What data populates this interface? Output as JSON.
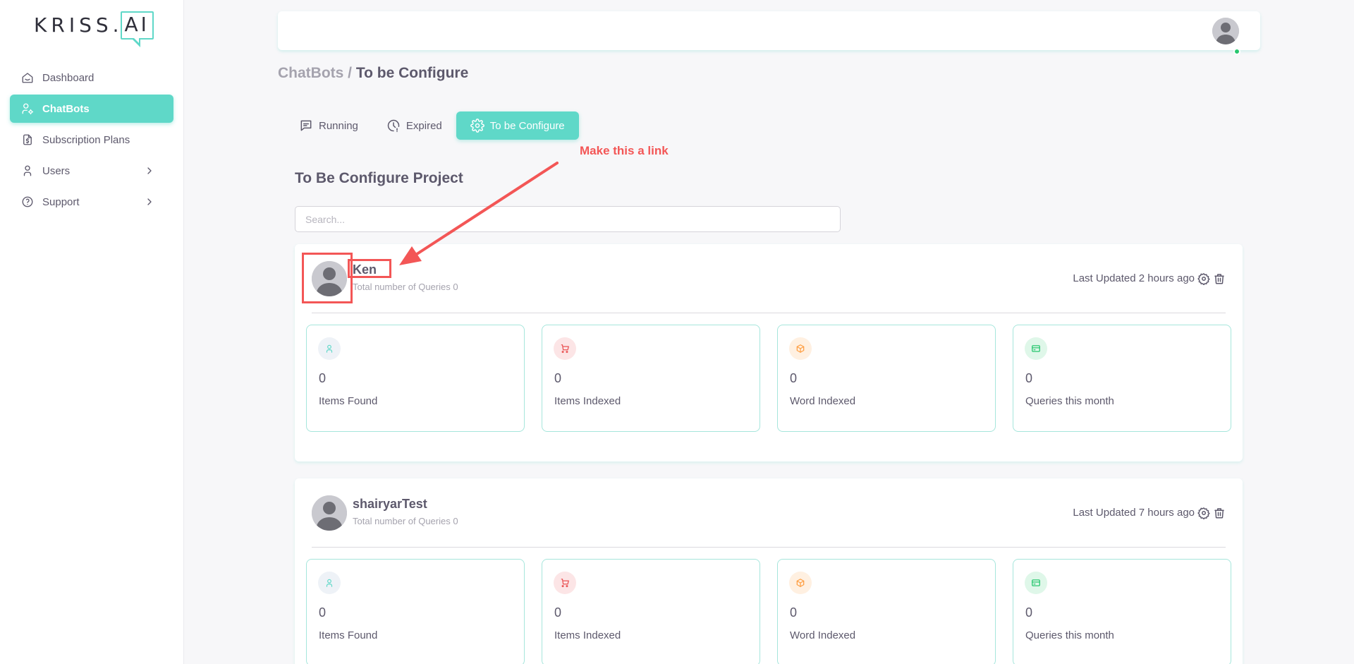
{
  "logo": {
    "text": "KRISS",
    "accent": "AI",
    "dot": "."
  },
  "sidebar": {
    "items": [
      {
        "label": "Dashboard",
        "icon": "home-icon",
        "active": false
      },
      {
        "label": "ChatBots",
        "icon": "user-cog-icon",
        "active": true
      },
      {
        "label": "Subscription Plans",
        "icon": "file-dollar-icon",
        "active": false
      },
      {
        "label": "Users",
        "icon": "user-icon",
        "active": false,
        "has_children": true
      },
      {
        "label": "Support",
        "icon": "help-circle-icon",
        "active": false,
        "has_children": true
      }
    ]
  },
  "breadcrumb": {
    "parent": "ChatBots /",
    "current": "To be Configure"
  },
  "tabs": [
    {
      "label": "Running",
      "icon": "message-icon",
      "active": false
    },
    {
      "label": "Expired",
      "icon": "clock-icon",
      "active": false
    },
    {
      "label": "To be Configure",
      "icon": "settings-icon",
      "active": true
    }
  ],
  "annotation": {
    "text": "Make this a link"
  },
  "section_title": "To Be Configure Project",
  "search": {
    "placeholder": "Search...",
    "value": ""
  },
  "projects": [
    {
      "name": "Ken",
      "subtitle": "Total number of Queries 0",
      "updated": "Last Updated 2 hours ago",
      "stats": [
        {
          "value": "0",
          "label": "Items Found",
          "icon": "user-icon"
        },
        {
          "value": "0",
          "label": "Items Indexed",
          "icon": "cart-icon"
        },
        {
          "value": "0",
          "label": "Word Indexed",
          "icon": "box-icon"
        },
        {
          "value": "0",
          "label": "Queries this month",
          "icon": "credit-card-icon"
        }
      ]
    },
    {
      "name": "shairyarTest",
      "subtitle": "Total number of Queries 0",
      "updated": "Last Updated 7 hours ago",
      "stats": [
        {
          "value": "0",
          "label": "Items Found",
          "icon": "user-icon"
        },
        {
          "value": "0",
          "label": "Items Indexed",
          "icon": "cart-icon"
        },
        {
          "value": "0",
          "label": "Word Indexed",
          "icon": "box-icon"
        },
        {
          "value": "0",
          "label": "Queries this month",
          "icon": "credit-card-icon"
        }
      ]
    }
  ],
  "colors": {
    "accent": "#5fd8c8",
    "annotation": "#f35656",
    "online": "#28c76f",
    "stat_user_bg": "#eef2f7",
    "stat_cart_bg": "#fce5e6",
    "stat_box_bg": "#fff0e1",
    "stat_card_bg": "#dff7e9"
  }
}
